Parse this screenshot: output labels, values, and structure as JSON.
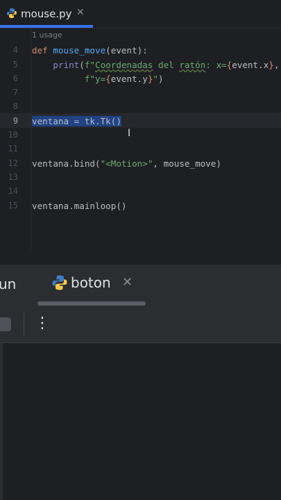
{
  "editor_tab": {
    "filename": "mouse.py",
    "close_glyph": "✕",
    "icon": "python-icon"
  },
  "usage_hint": "1 usage",
  "lines": [
    {
      "num": "4"
    },
    {
      "num": "5"
    },
    {
      "num": "6"
    },
    {
      "num": "7"
    },
    {
      "num": "8"
    },
    {
      "num": "9"
    },
    {
      "num": "10"
    },
    {
      "num": "11"
    },
    {
      "num": "12"
    },
    {
      "num": "13"
    },
    {
      "num": "14"
    },
    {
      "num": "15"
    }
  ],
  "code": {
    "l4_kw": "def",
    "l4_fn": "mouse_move",
    "l4_rest": "(event):",
    "l5_indent": "    ",
    "l5_fn": "print",
    "l5_open": "(",
    "l5_strA": "f\"",
    "l5_strB": "Coordenadas",
    "l5_strC": " del ",
    "l5_strD": "ratón",
    "l5_strE": ": x=",
    "l5_b1": "{",
    "l5_var": "event.x",
    "l5_b2": "}",
    "l5_comma": ",",
    "l6_indent": "          ",
    "l6_strA": "f\"y=",
    "l6_b1": "{",
    "l6_var": "event.y",
    "l6_b2": "}",
    "l6_strB": "\"",
    "l6_close": ")",
    "l9_code": "ventana = tk.Tk()",
    "l12_a": "ventana.bind(",
    "l12_str": "\"<Motion>\"",
    "l12_b": ", mouse_move)",
    "l15_code": "ventana.mainloop()"
  },
  "run_panel": {
    "prev_tab_fragment": "un",
    "tab_label": "boton",
    "close_glyph": "✕",
    "more_glyph": "⋮"
  },
  "colors": {
    "accent": "#3574f0",
    "selection": "#214283",
    "keyword": "#cf8e6d",
    "function": "#56a8f5",
    "string": "#6aab73"
  }
}
